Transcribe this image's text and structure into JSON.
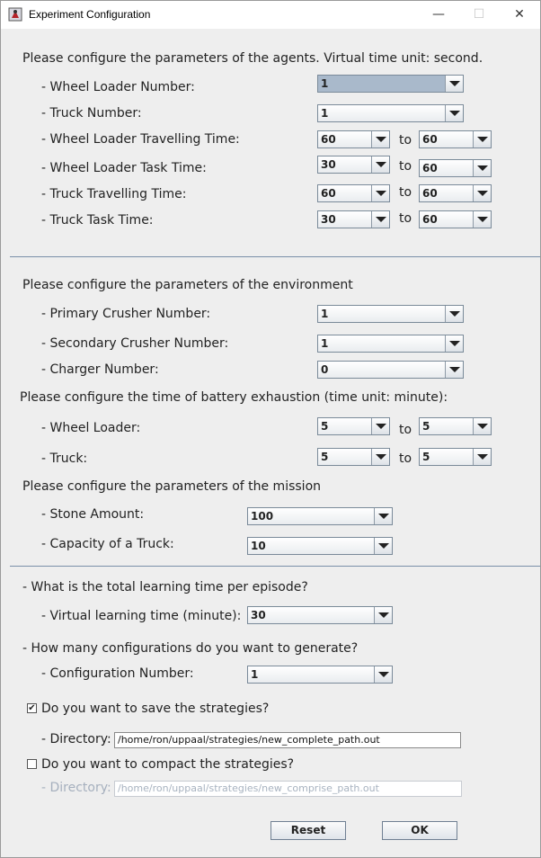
{
  "window": {
    "title": "Experiment Configuration",
    "minimize_glyph": "—",
    "maximize_glyph": "☐",
    "close_glyph": "✕"
  },
  "agents": {
    "header": "Please configure the parameters of the agents. Virtual time unit: second.",
    "wheel_loader_number_label": "- Wheel Loader Number:",
    "wheel_loader_number_value": "1",
    "truck_number_label": "- Truck Number:",
    "truck_number_value": "1",
    "wl_travel_label": "- Wheel Loader Travelling Time:",
    "wl_travel_from": "60",
    "wl_travel_to": "60",
    "wl_task_label": "- Wheel Loader Task Time:",
    "wl_task_from": "30",
    "wl_task_to": "60",
    "truck_travel_label": "- Truck Travelling Time:",
    "truck_travel_from": "60",
    "truck_travel_to": "60",
    "truck_task_label": "- Truck Task Time:",
    "truck_task_from": "30",
    "truck_task_to": "60",
    "to_text": "to"
  },
  "environment": {
    "header": "Please configure the parameters of the environment",
    "primary_label": "- Primary Crusher Number:",
    "primary_value": "1",
    "secondary_label": "- Secondary Crusher Number:",
    "secondary_value": "1",
    "charger_label": "- Charger Number:",
    "charger_value": "0"
  },
  "battery": {
    "header": "Please configure the time of battery exhaustion (time unit: minute):",
    "wheel_loader_label": "- Wheel Loader:",
    "wheel_loader_from": "5",
    "wheel_loader_to": "5",
    "truck_label": "- Truck:",
    "truck_from": "5",
    "truck_to": "5"
  },
  "mission": {
    "header": "Please configure the parameters of the mission",
    "stone_label": "- Stone Amount:",
    "stone_value": "100",
    "capacity_label": "- Capacity of a Truck:",
    "capacity_value": "10"
  },
  "learning": {
    "question": "- What is the total learning time per episode?",
    "time_label": "- Virtual learning time (minute):",
    "time_value": "30",
    "config_question": "- How many configurations do you want to generate?",
    "config_label": "- Configuration Number:",
    "config_value": "1"
  },
  "save": {
    "checked": true,
    "check_glyph": "✔",
    "label": "Do you want to save the strategies?",
    "dir_label": "- Directory:",
    "dir_value": "/home/ron/uppaal/strategies/new_complete_path.out"
  },
  "compact": {
    "checked": false,
    "label": "Do you want to compact the strategies?",
    "dir_label": "- Directory:",
    "dir_value": "/home/ron/uppaal/strategies/new_comprise_path.out"
  },
  "buttons": {
    "reset": "Reset",
    "ok": "OK"
  }
}
